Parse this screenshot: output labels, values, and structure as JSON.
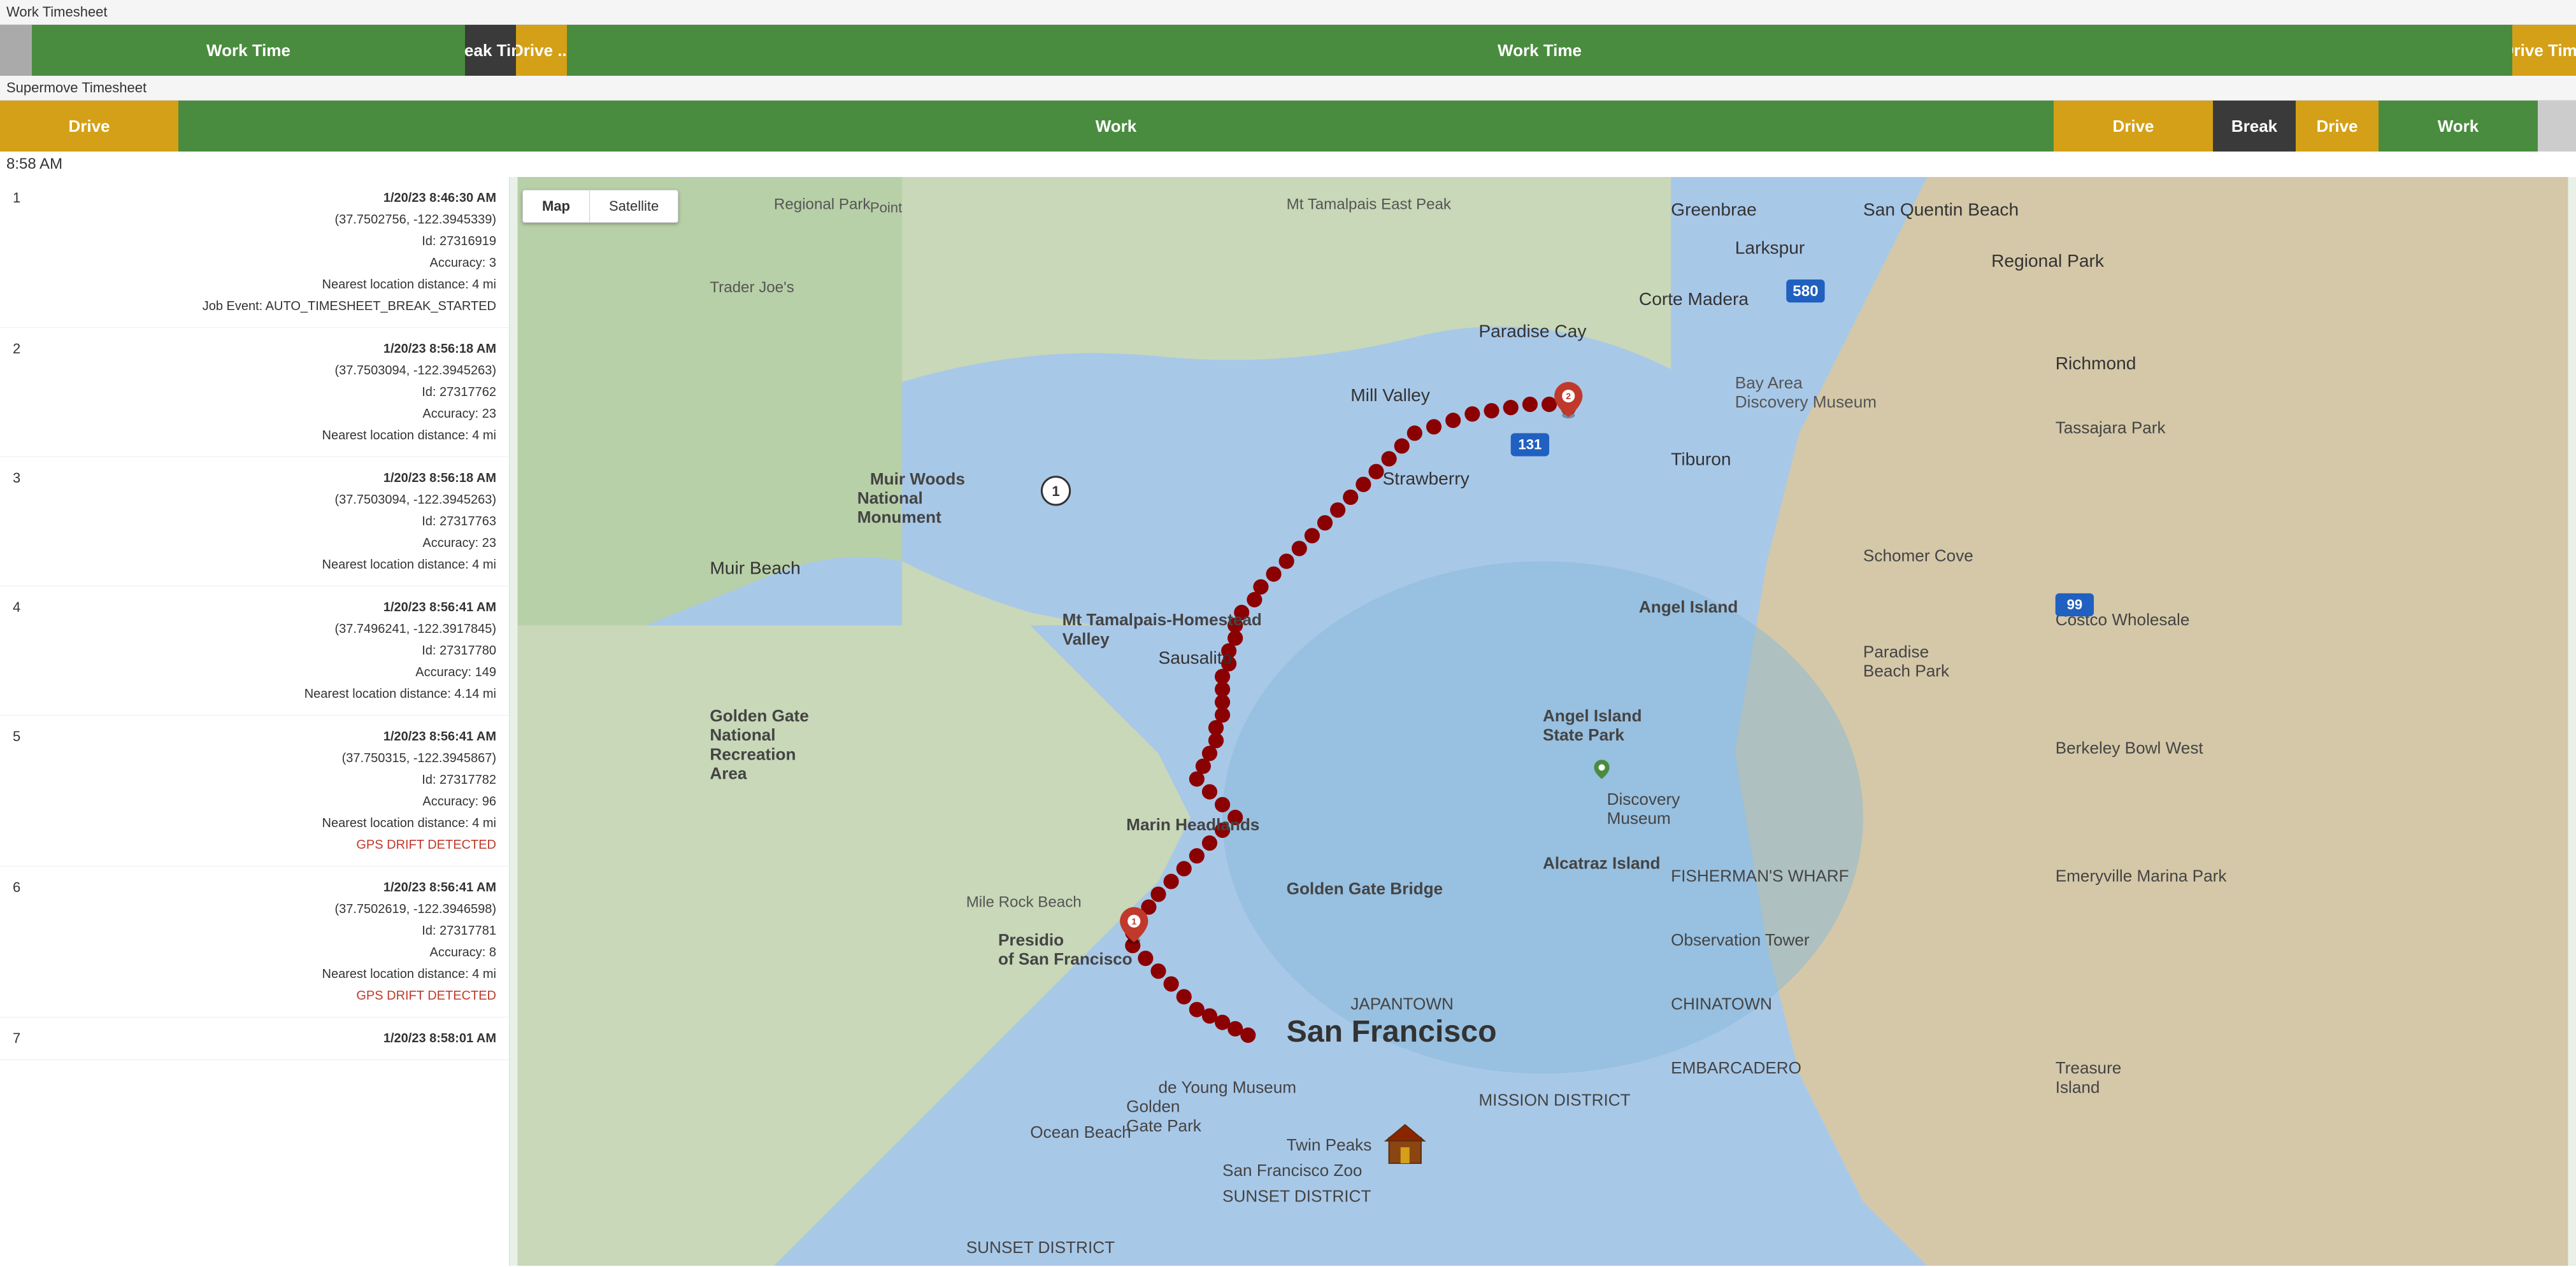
{
  "work_timesheet": {
    "label": "Work Timesheet",
    "bar": {
      "segments": [
        {
          "key": "gray",
          "label": ""
        },
        {
          "key": "green-work",
          "label": "Work Time"
        },
        {
          "key": "break-dark",
          "label": "Break Time"
        },
        {
          "key": "drive-gold",
          "label": "Drive ..."
        },
        {
          "key": "green-work2",
          "label": "Work Time"
        },
        {
          "key": "drive-time",
          "label": "Drive Time"
        }
      ]
    }
  },
  "supermove_timesheet": {
    "label": "Supermove Timesheet",
    "bar": {
      "segments": [
        {
          "key": "drive-gold",
          "label": "Drive"
        },
        {
          "key": "green-work",
          "label": "Work"
        },
        {
          "key": "drive2",
          "label": "Drive"
        },
        {
          "key": "break-dark",
          "label": "Break"
        },
        {
          "key": "drive3",
          "label": "Drive"
        },
        {
          "key": "work2",
          "label": "Work"
        },
        {
          "key": "light",
          "label": ""
        }
      ]
    }
  },
  "time_display": "8:58 AM",
  "map": {
    "toggle_map": "Map",
    "toggle_satellite": "Satellite"
  },
  "entries": [
    {
      "number": "1",
      "timestamp": "1/20/23 8:46:30 AM",
      "coords": "(37.7502756, -122.3945339)",
      "id": "Id: 27316919",
      "accuracy": "Accuracy: 3",
      "nearest": "Nearest location distance: 4 mi",
      "event": "Job Event: AUTO_TIMESHEET_BREAK_STARTED"
    },
    {
      "number": "2",
      "timestamp": "1/20/23 8:56:18 AM",
      "coords": "(37.7503094, -122.3945263)",
      "id": "Id: 27317762",
      "accuracy": "Accuracy: 23",
      "nearest": "Nearest location distance: 4 mi",
      "event": ""
    },
    {
      "number": "3",
      "timestamp": "1/20/23 8:56:18 AM",
      "coords": "(37.7503094, -122.3945263)",
      "id": "Id: 27317763",
      "accuracy": "Accuracy: 23",
      "nearest": "Nearest location distance: 4 mi",
      "event": ""
    },
    {
      "number": "4",
      "timestamp": "1/20/23 8:56:41 AM",
      "coords": "(37.7496241, -122.3917845)",
      "id": "Id: 27317780",
      "accuracy": "Accuracy: 149",
      "nearest": "Nearest location distance: 4.14 mi",
      "event": ""
    },
    {
      "number": "5",
      "timestamp": "1/20/23 8:56:41 AM",
      "coords": "(37.750315, -122.3945867)",
      "id": "Id: 27317782",
      "accuracy": "Accuracy: 96",
      "nearest": "Nearest location distance: 4 mi",
      "event": "GPS DRIFT DETECTED"
    },
    {
      "number": "6",
      "timestamp": "1/20/23 8:56:41 AM",
      "coords": "(37.7502619, -122.3946598)",
      "id": "Id: 27317781",
      "accuracy": "Accuracy: 8",
      "nearest": "Nearest location distance: 4 mi",
      "event": "GPS DRIFT DETECTED"
    },
    {
      "number": "7",
      "timestamp": "1/20/23 8:58:01 AM",
      "coords": "",
      "id": "",
      "accuracy": "",
      "nearest": "",
      "event": ""
    }
  ],
  "map_labels": {
    "greenbrae": "Greenbrae",
    "larkspur": "Larkspur",
    "corte_madera": "Corte Madera",
    "mill_valley": "Mill Valley",
    "muir_beach": "Muir Beach",
    "sausalito": "Sausalito",
    "san_francisco": "San Francisco",
    "tiburon": "Tiburon",
    "richmond": "Richmond",
    "berkeley": "Berkeley",
    "regional_park": "Regional Park",
    "alcatraz": "Alcatraz Island",
    "presidio": "Presidio\nof San Francisco",
    "marin_headlands": "Marin Headlands",
    "paradise_cay": "Paradise Cay",
    "strawberry": "Strawberry",
    "golden_gate": "Golden Gate\nNational Recreation\nArea",
    "mile_rock": "Mile Rock Beach",
    "fishermans": "FISHERMAN'S\nWHARF",
    "chinatown": "CHINATOWN",
    "mission": "MISSION\nDISTRICT",
    "twin_peaks": "Twin Peaks",
    "sunset": "SUNSET DISTRICT",
    "japantown": "JAPANTOWN",
    "ocean_beach": "Ocean Beach",
    "embarcadero": "EMBARCADERO",
    "discovery": "Discovery\nMuseum"
  }
}
